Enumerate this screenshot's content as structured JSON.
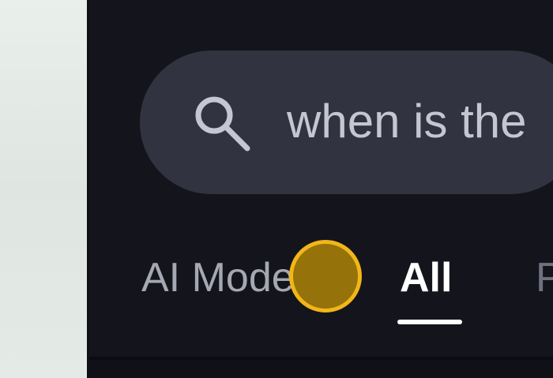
{
  "search": {
    "query": "when is the",
    "icon": "search-icon"
  },
  "tabs": [
    {
      "label": "AI Mode",
      "selected": false
    },
    {
      "label": "All",
      "selected": true
    },
    {
      "label": "P",
      "selected": false
    }
  ],
  "colors": {
    "background": "#14151c",
    "search_bar": "#313340",
    "tab_active": "#ffffff",
    "tab_inactive": "#a5a8b3",
    "tap_indicator": "#f2b619"
  }
}
